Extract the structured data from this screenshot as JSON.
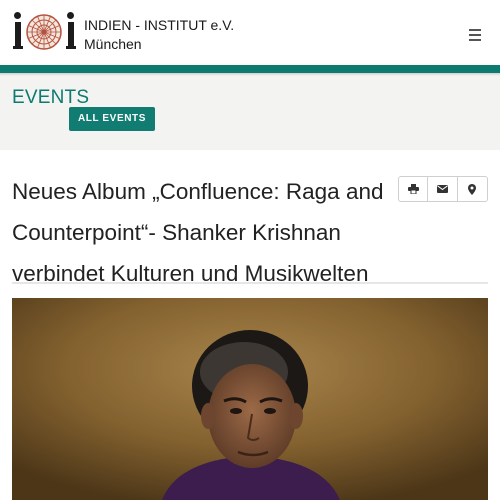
{
  "header": {
    "org_name": "INDIEN - INSTITUT e.V.",
    "org_city": "München",
    "menu_icon": "hamburger-menu-icon"
  },
  "events": {
    "section_title": "EVENTS",
    "all_events_label": "ALL EVENTS"
  },
  "article": {
    "title": "Neues Album „Confluence: Raga and Counterpoint“- Shanker Krishnan verbindet Kulturen und Musikwelten",
    "actions": [
      {
        "icon": "print-icon"
      },
      {
        "icon": "envelope-icon"
      },
      {
        "icon": "map-pin-icon"
      }
    ]
  },
  "colors": {
    "accent": "#0d7a6f",
    "button": "#117d72",
    "band_bg": "#f3f3f1"
  }
}
